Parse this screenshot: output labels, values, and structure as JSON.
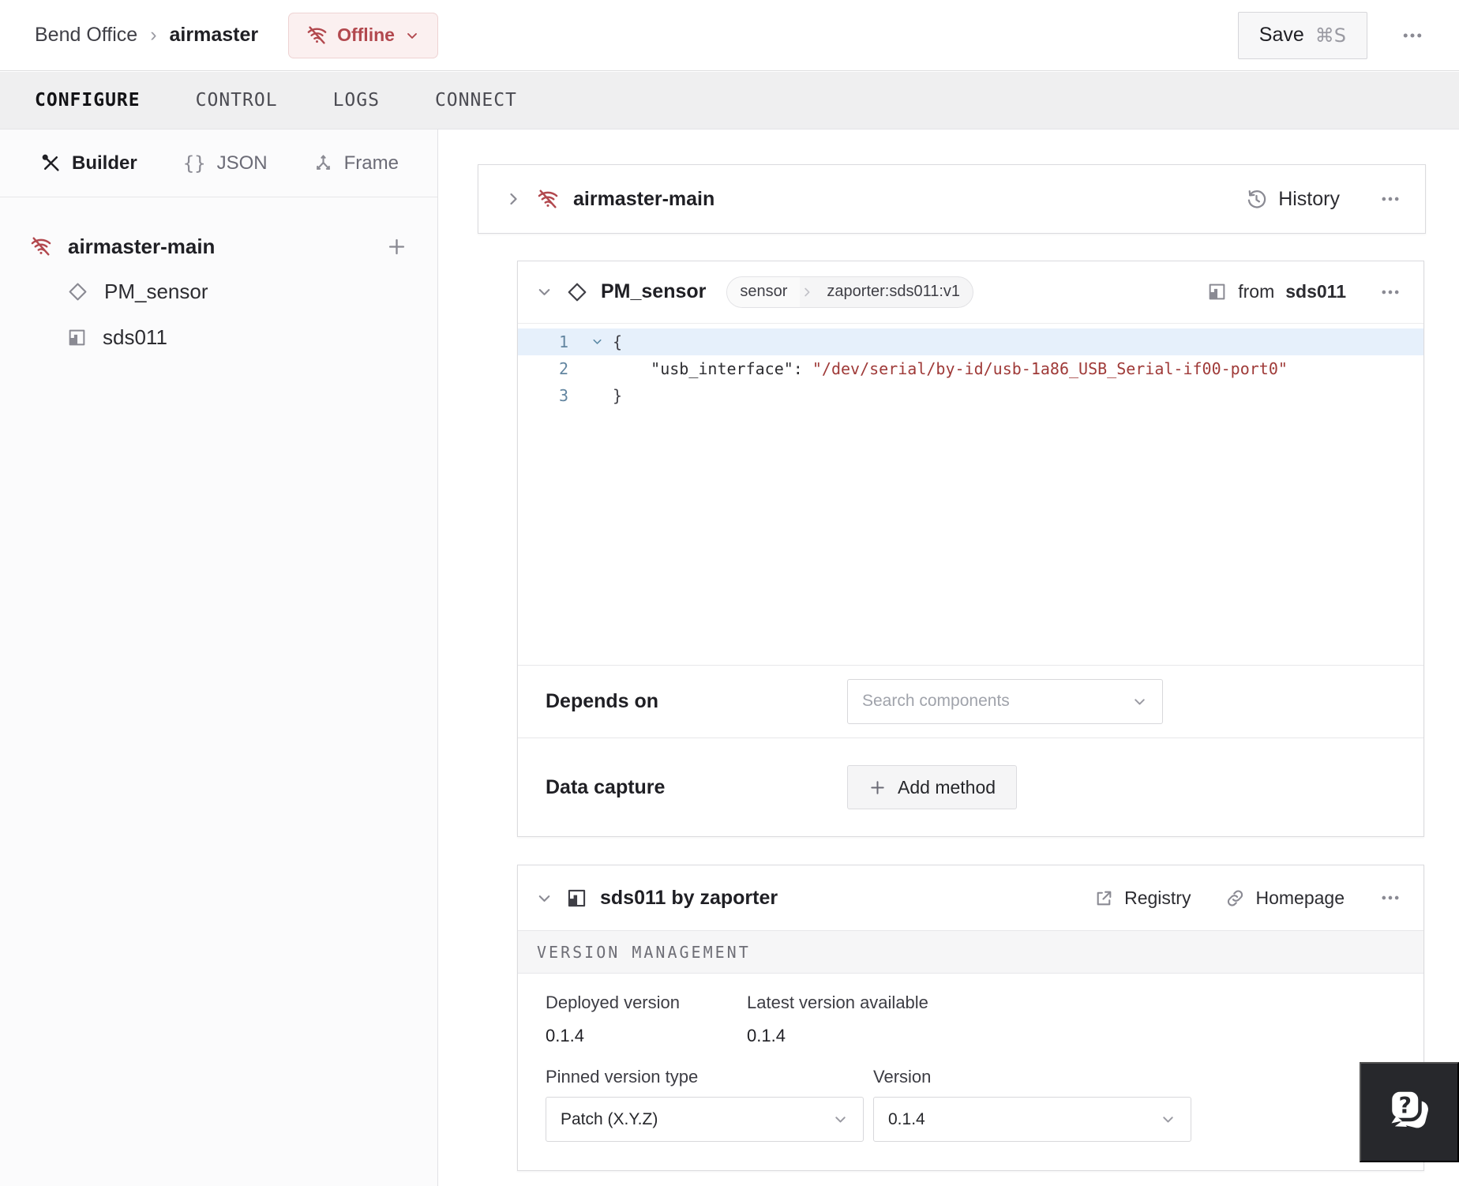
{
  "header": {
    "breadcrumb": {
      "org": "Bend Office",
      "separator": "›",
      "machine": "airmaster"
    },
    "status_label": "Offline",
    "save_label": "Save",
    "save_shortcut": "⌘S"
  },
  "tabs": {
    "configure": "CONFIGURE",
    "control": "CONTROL",
    "logs": "LOGS",
    "connect": "CONNECT"
  },
  "sidebar": {
    "modes": {
      "builder": "Builder",
      "json_braces": "{}",
      "json": "JSON",
      "frame": "Frame"
    },
    "tree": {
      "root": "airmaster-main",
      "child1": "PM_sensor",
      "child2": "sds011"
    }
  },
  "part": {
    "title": "airmaster-main",
    "history": "History"
  },
  "sensor": {
    "title": "PM_sensor",
    "badge_type": "sensor",
    "badge_model": "zaporter:sds011:v1",
    "from_prefix": "from",
    "from_module": "sds011",
    "code": {
      "num1": "1",
      "num2": "2",
      "num3": "3",
      "line1": "{",
      "line2_indent": "    ",
      "line2_key": "\"usb_interface\":",
      "line2_space": " ",
      "line2_value": "\"/dev/serial/by-id/usb-1a86_USB_Serial-if00-port0\"",
      "line3": "}"
    },
    "depends": {
      "label": "Depends on",
      "placeholder": "Search components"
    },
    "capture": {
      "label": "Data capture",
      "add_button": "Add method"
    }
  },
  "module": {
    "title": "sds011 by zaporter",
    "registry": "Registry",
    "homepage": "Homepage",
    "section": "VERSION MANAGEMENT",
    "deployed_label": "Deployed version",
    "deployed_value": "0.1.4",
    "latest_label": "Latest version available",
    "latest_value": "0.1.4",
    "pinned_label": "Pinned version type",
    "pinned_value": "Patch (X.Y.Z)",
    "version_label": "Version",
    "version_value": "0.1.4"
  },
  "colors": {
    "offline_text": "#b2484e",
    "offline_bg": "#fbf0f0",
    "code_string": "#9f3a38",
    "line_number": "#6285a0",
    "active_line_bg": "#e6f0fb",
    "tabbar_bg": "#efeff0",
    "help_bg": "#27282c"
  }
}
